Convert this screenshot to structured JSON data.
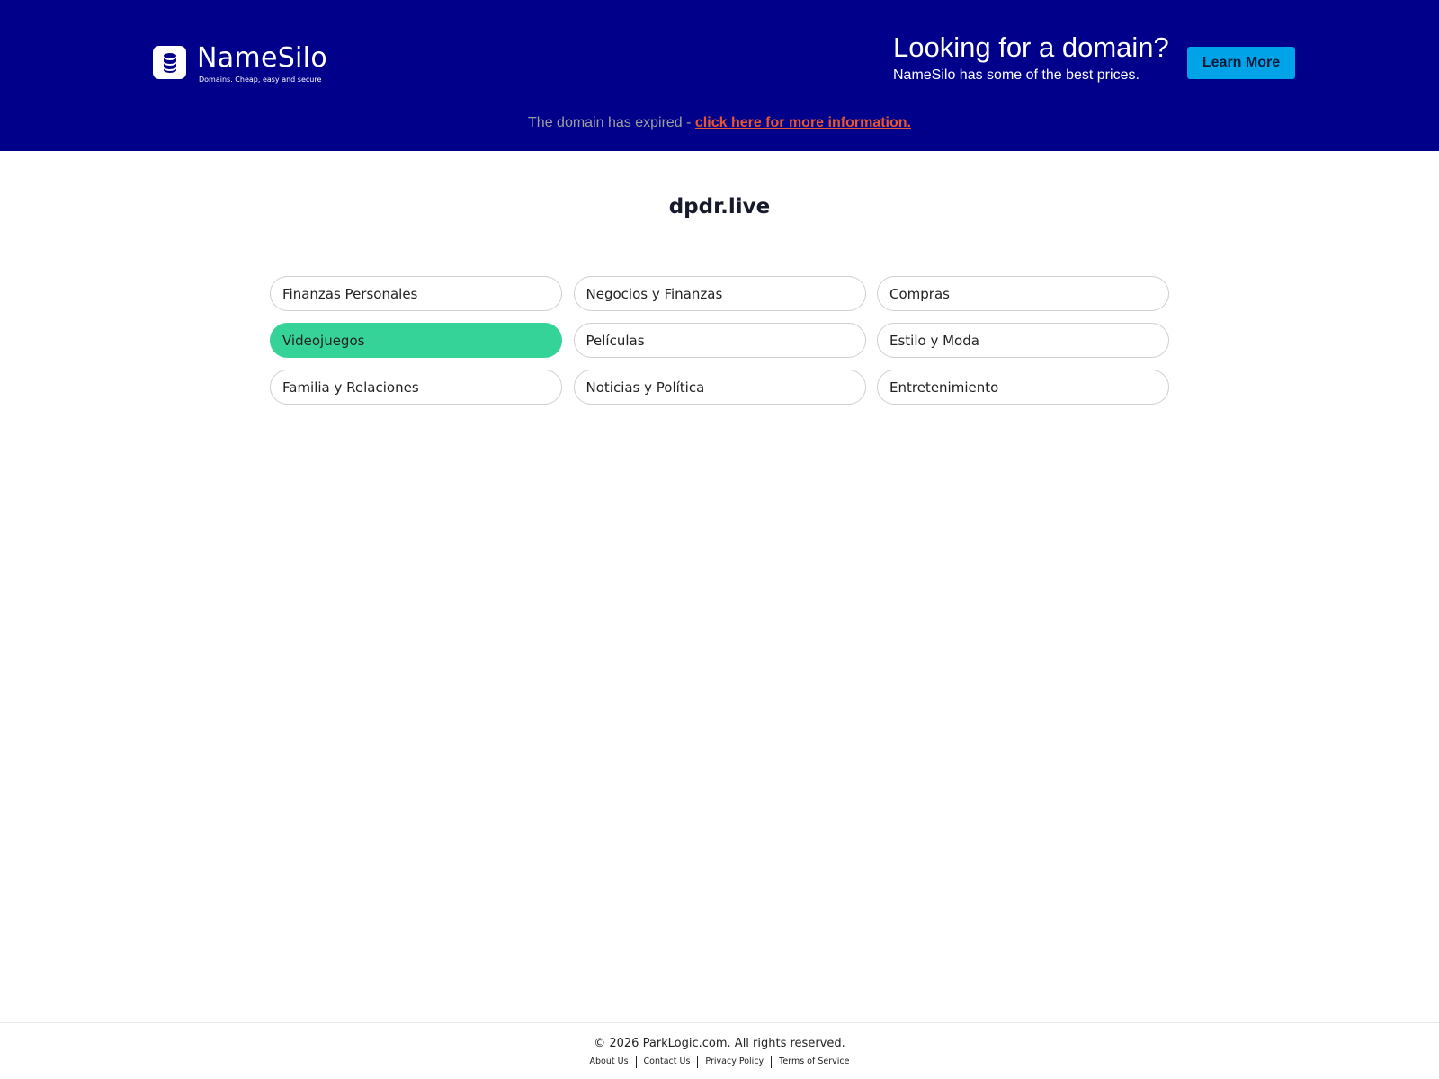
{
  "colors": {
    "banner_bg": "#00008b",
    "button_bg": "#00a3e8",
    "link": "#e8572f",
    "active_pill": "#36d399"
  },
  "logo": {
    "icon": "database-icon",
    "name": "NameSilo",
    "tagline": "Domains. Cheap, easy and secure"
  },
  "promo": {
    "title": "Looking for a domain?",
    "subtitle": "NameSilo has some of the best prices.",
    "button_label": "Learn More"
  },
  "notice": {
    "text": "The domain has expired - ",
    "link_text": "click here for more information."
  },
  "domain": "dpdr.live",
  "categories": [
    {
      "label": "Finanzas Personales",
      "active": false
    },
    {
      "label": "Negocios y Finanzas",
      "active": false
    },
    {
      "label": "Compras",
      "active": false
    },
    {
      "label": "Videojuegos",
      "active": true
    },
    {
      "label": "Películas",
      "active": false
    },
    {
      "label": "Estilo y Moda",
      "active": false
    },
    {
      "label": "Familia y Relaciones",
      "active": false
    },
    {
      "label": "Noticias y Política",
      "active": false
    },
    {
      "label": "Entretenimiento",
      "active": false
    }
  ],
  "footer": {
    "copyright": "© 2026 ParkLogic.com. All rights reserved.",
    "links": [
      "About Us",
      "Contact Us",
      "Privacy Policy",
      "Terms of Service"
    ]
  }
}
